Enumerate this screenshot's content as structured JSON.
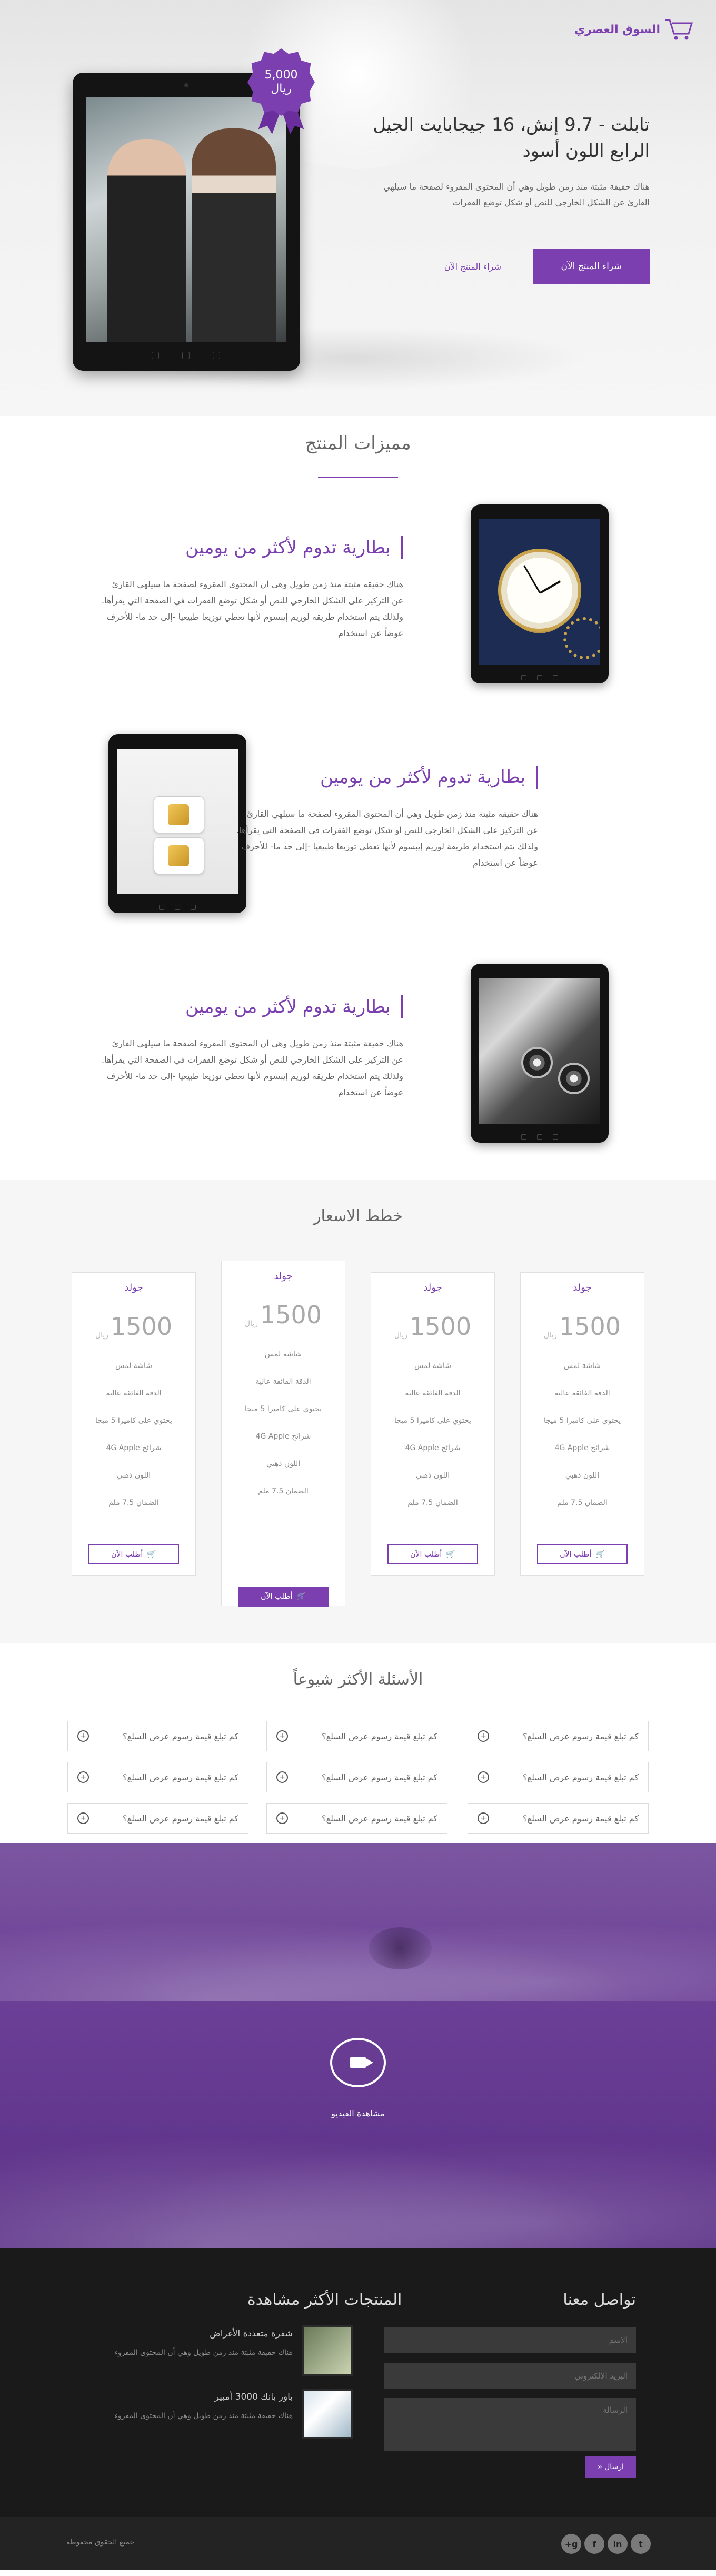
{
  "brand": {
    "name": "السوق العصري",
    "accent": "#7b3fb0"
  },
  "hero": {
    "badge_price": "5,000",
    "badge_currency": "ريال",
    "title_line1": "تابلت - 9.7 إنش، 16 جيجابايت الجيل",
    "title_line2": "الرابع اللون أسود",
    "description": "هناك حقيقة مثبتة منذ زمن طويل وهي أن المحتوى المقروء لصفحة ما سيلهي القارئ عن الشكل الخارجي للنص أو شكل توضع الفقرات",
    "buy_label": "شراء المنتج الآن",
    "more_label": "شراء المنتج الآن"
  },
  "features": {
    "title": "مميزات المنتج",
    "items": [
      {
        "heading": "بطارية تدوم لأكثر من يومين",
        "text": "هناك حقيقة مثبتة منذ زمن طويل وهي أن المحتوى المقروء لصفحة ما سيلهي القارئ عن التركيز على الشكل الخارجي للنص أو شكل توضع الفقرات في الصفحة التي يقرأها. ولذلك يتم استخدام طريقة لوريم إيبسوم لأنها تعطي توزيعا طبيعيا -إلى حد ما- للأحرف عوضاً عن استخدام"
      },
      {
        "heading": "بطارية تدوم لأكثر من يومين",
        "text": "هناك حقيقة مثبتة منذ زمن طويل وهي أن المحتوى المقروء لصفحة ما سيلهي القارئ عن التركيز على الشكل الخارجي للنص أو شكل توضع الفقرات في الصفحة التي يقرأها. ولذلك يتم استخدام طريقة لوريم إيبسوم لأنها تعطي توزيعا طبيعيا -إلى حد ما- للأحرف عوضاً عن استخدام"
      },
      {
        "heading": "بطارية تدوم لأكثر من يومين",
        "text": "هناك حقيقة مثبتة منذ زمن طويل وهي أن المحتوى المقروء لصفحة ما سيلهي القارئ عن التركيز على الشكل الخارجي للنص أو شكل توضع الفقرات في الصفحة التي يقرأها. ولذلك يتم استخدام طريقة لوريم إيبسوم لأنها تعطي توزيعا طبيعيا -إلى حد ما- للأحرف عوضاً عن استخدام"
      }
    ]
  },
  "pricing": {
    "title": "خطط الاسعار",
    "plans": [
      {
        "name": "جولد",
        "price": "1500",
        "currency": "ريال",
        "features": [
          "شاشة لمس",
          "الدقة الفائقة عالية",
          "يحتوي على كاميرا 5 ميجا",
          "شرائح 4G Apple",
          "اللون ذهبي",
          "الضمان 7.5 ملم"
        ],
        "order": "أطلب الآن"
      },
      {
        "name": "جولد",
        "price": "1500",
        "currency": "ريال",
        "features": [
          "شاشة لمس",
          "الدقة الفائقة عالية",
          "يحتوي على كاميرا 5 ميجا",
          "شرائح 4G Apple",
          "اللون ذهبي",
          "الضمان 7.5 ملم"
        ],
        "order": "أطلب الآن"
      },
      {
        "name": "جولد",
        "price": "1500",
        "currency": "ريال",
        "features": [
          "شاشة لمس",
          "الدقة الفائقة عالية",
          "يحتوي على كاميرا 5 ميجا",
          "شرائح 4G Apple",
          "اللون ذهبي",
          "الضمان 7.5 ملم"
        ],
        "order": "أطلب الآن"
      },
      {
        "name": "جولد",
        "price": "1500",
        "currency": "ريال",
        "features": [
          "شاشة لمس",
          "الدقة الفائقة عالية",
          "يحتوي على كاميرا 5 ميجا",
          "شرائح 4G Apple",
          "اللون ذهبي",
          "الضمان 7.5 ملم"
        ],
        "order": "أطلب الآن"
      }
    ]
  },
  "faq": {
    "title": "الأسئلة الأكثر شيوعاً",
    "questions": [
      "كم تبلغ قيمة رسوم عرض السلع؟",
      "كم تبلغ قيمة رسوم عرض السلع؟",
      "كم تبلغ قيمة رسوم عرض السلع؟",
      "كم تبلغ قيمة رسوم عرض السلع؟",
      "كم تبلغ قيمة رسوم عرض السلع؟",
      "كم تبلغ قيمة رسوم عرض السلع؟",
      "كم تبلغ قيمة رسوم عرض السلع؟",
      "كم تبلغ قيمة رسوم عرض السلع؟",
      "كم تبلغ قيمة رسوم عرض السلع؟"
    ]
  },
  "video": {
    "label": "مشاهدة الفيديو"
  },
  "contact": {
    "title": "تواصل معنا",
    "name_placeholder": "الاسم",
    "email_placeholder": "البريد الالكتروني",
    "message_placeholder": "الرسالة",
    "send_label": "ارسال"
  },
  "popular": {
    "title": "المنتجات الأكثر مشاهدة",
    "items": [
      {
        "name": "شفرة متعددة الأغراض",
        "desc": "هناك حقيقة مثبتة منذ زمن طويل وهي أن المحتوى المقروء"
      },
      {
        "name": "باور بانك 3000 أمبير",
        "desc": "هناك حقيقة مثبتة منذ زمن طويل وهي أن المحتوى المقروء"
      }
    ]
  },
  "footer": {
    "copyright": "جميع الحقوق محفوظة",
    "social": [
      "twitter-icon",
      "linkedin-icon",
      "facebook-icon",
      "google-plus-icon"
    ]
  }
}
